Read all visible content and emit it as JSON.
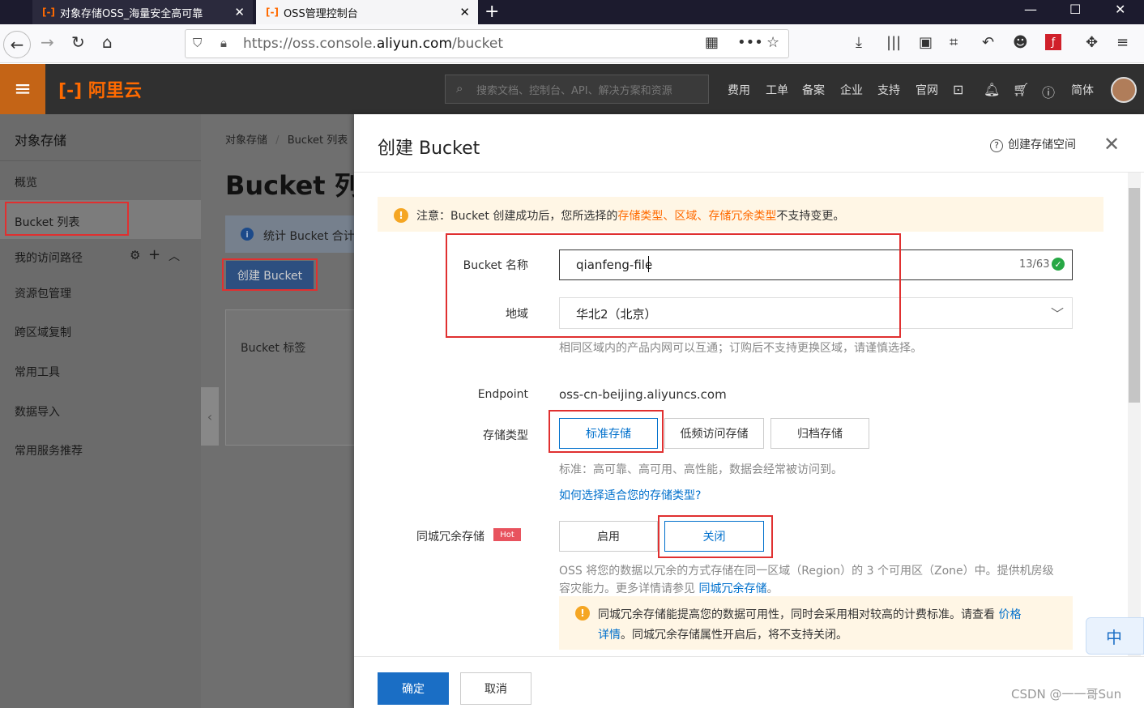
{
  "browser": {
    "tabs": [
      {
        "title": "对象存储OSS_海量安全高可靠",
        "favicon": "[-]"
      },
      {
        "title": "OSS管理控制台",
        "favicon": "[-]"
      }
    ],
    "url_prefix": "https://oss.console.",
    "url_domain": "aliyun.com",
    "url_path": "/bucket"
  },
  "header": {
    "logo": "[-] 阿里云",
    "search_placeholder": "搜索文档、控制台、API、解决方案和资源",
    "nav": [
      "费用",
      "工单",
      "备案",
      "企业",
      "支持",
      "官网"
    ],
    "lang": "简体"
  },
  "sidebar": {
    "title": "对象存储",
    "items": [
      "概览",
      "Bucket 列表",
      "我的访问路径",
      "资源包管理",
      "跨区域复制",
      "常用工具",
      "数据导入",
      "常用服务推荐"
    ]
  },
  "main": {
    "breadcrumb_root": "对象存储",
    "breadcrumb_sep": "/",
    "breadcrumb_current": "Bucket 列表",
    "title": "Bucket 列表",
    "info": "统计 Bucket 合计",
    "create_button": "创建 Bucket",
    "tag_label": "Bucket 标签"
  },
  "dialog": {
    "title": "创建 Bucket",
    "help": "创建存储空间",
    "notice_prefix": "注意：Bucket 创建成功后，您所选择的",
    "notice_link": "存储类型、区域、存储冗余类型",
    "notice_suffix": "不支持变更。",
    "name_label": "Bucket 名称",
    "name_value": "qianfeng-file",
    "name_count": "13/63",
    "region_label": "地域",
    "region_value": "华北2（北京）",
    "region_hint": "相同区域内的产品内网可以互通；订购后不支持更换区域，请谨慎选择。",
    "endpoint_label": "Endpoint",
    "endpoint_value": "oss-cn-beijing.aliyuncs.com",
    "storage_label": "存储类型",
    "storage_options": [
      "标准存储",
      "低频访问存储",
      "归档存储"
    ],
    "storage_hint": "标准：高可靠、高可用、高性能，数据会经常被访问到。",
    "storage_link": "如何选择适合您的存储类型?",
    "redundancy_label": "同城冗余存储",
    "hot_badge": "Hot",
    "redundancy_options": [
      "启用",
      "关闭"
    ],
    "redundancy_hint1": "OSS 将您的数据以冗余的方式存储在同一区域（Region）的 3 个可用区（Zone）中。提供机房级",
    "redundancy_hint2": "容灾能力。更多详情请参见",
    "redundancy_link": "同城冗余存储",
    "redundancy_hint_end": "。",
    "warn_line1": "同城冗余存储能提高您的数据可用性，同时会采用相对较高的计费标准。请查看",
    "warn_link1": "价格",
    "warn_link2": "详情",
    "warn_line2": "。同城冗余存储属性开启后，将不支持关闭。",
    "confirm": "确定",
    "cancel": "取消"
  },
  "ime": "中",
  "watermark": "CSDN @一一哥Sun"
}
